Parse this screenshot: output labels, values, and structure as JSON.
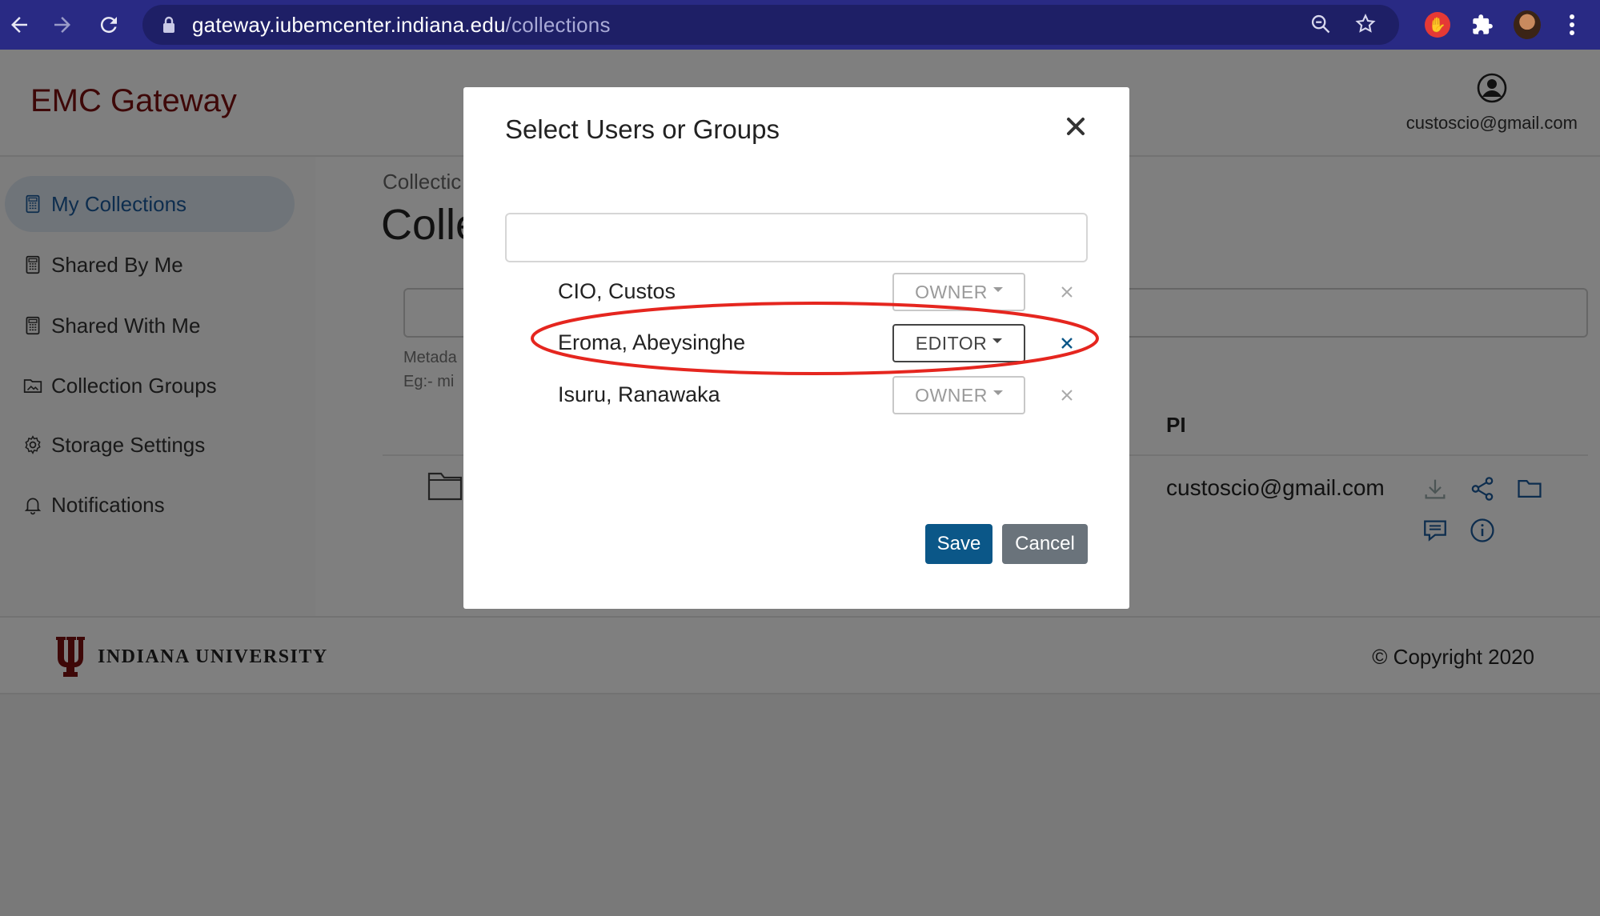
{
  "browser": {
    "url_host": "gateway.iubemcenter.indiana.edu",
    "url_path": "/collections"
  },
  "header": {
    "brand": "EMC Gateway",
    "user_email": "custoscio@gmail.com"
  },
  "sidebar": {
    "items": [
      {
        "label": "My Collections",
        "icon": "calculator-icon",
        "active": true
      },
      {
        "label": "Shared By Me",
        "icon": "calculator-icon"
      },
      {
        "label": "Shared With Me",
        "icon": "calculator-icon"
      },
      {
        "label": "Collection Groups",
        "icon": "folder-image-icon"
      },
      {
        "label": "Storage Settings",
        "icon": "gear-icon"
      },
      {
        "label": "Notifications",
        "icon": "bell-icon"
      }
    ]
  },
  "main": {
    "breadcrumb": "Collectic",
    "title": "Colle",
    "meta_label": "Metada",
    "meta_example": "Eg:- mi",
    "column_pi": "PI",
    "row_pi_email": "custoscio@gmail.com",
    "row_partial": ")"
  },
  "modal": {
    "title": "Select Users or Groups",
    "search_value": "",
    "users": [
      {
        "name": "CIO, Custos",
        "role": "OWNER",
        "editable": false
      },
      {
        "name": "Eroma, Abeysinghe",
        "role": "EDITOR",
        "editable": true
      },
      {
        "name": "Isuru, Ranawaka",
        "role": "OWNER",
        "editable": false
      }
    ],
    "save_label": "Save",
    "cancel_label": "Cancel"
  },
  "footer": {
    "university": "INDIANA UNIVERSITY",
    "copyright": "© Copyright 2020"
  },
  "colors": {
    "browser_bar": "#292a84",
    "brand": "#7d1010",
    "save_button": "#0b5788",
    "cancel_button": "#6a737b",
    "highlight": "#e5261f"
  }
}
